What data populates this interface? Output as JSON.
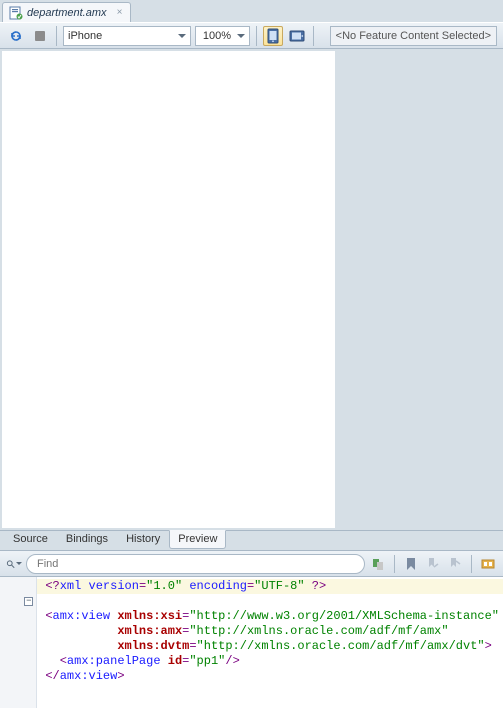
{
  "tab": {
    "filename": "department.amx"
  },
  "toolbar": {
    "device": "iPhone",
    "zoom": "100%",
    "feature_placeholder": "<No Feature Content Selected>"
  },
  "bottom_tabs": [
    "Source",
    "Bindings",
    "History",
    "Preview"
  ],
  "bottom_tabs_active_index": 3,
  "find": {
    "placeholder": "Find"
  },
  "code": {
    "line1": {
      "a": "<?",
      "b": "xml version",
      "c": "=",
      "d": "\"1.0\"",
      "e": " encoding",
      "f": "=",
      "g": "\"UTF-8\"",
      "h": " ?>"
    },
    "line2": {
      "a": "<",
      "b": "amx:view",
      "c": " xmlns:xsi",
      "d": "=",
      "e": "\"http://www.w3.org/2001/XMLSchema-instance\""
    },
    "line3": {
      "c": "xmlns:amx",
      "d": "=",
      "e": "\"http://xmlns.oracle.com/adf/mf/amx\""
    },
    "line4": {
      "c": "xmlns:dvtm",
      "d": "=",
      "e": "\"http://xmlns.oracle.com/adf/mf/amx/dvt\"",
      "f": ">"
    },
    "line5": {
      "a": "  <",
      "b": "amx:panelPage",
      "c": " id",
      "d": "=",
      "e": "\"pp1\"",
      "f": "/>"
    },
    "line6": {
      "a": "</",
      "b": "amx:view",
      "c": ">"
    }
  }
}
